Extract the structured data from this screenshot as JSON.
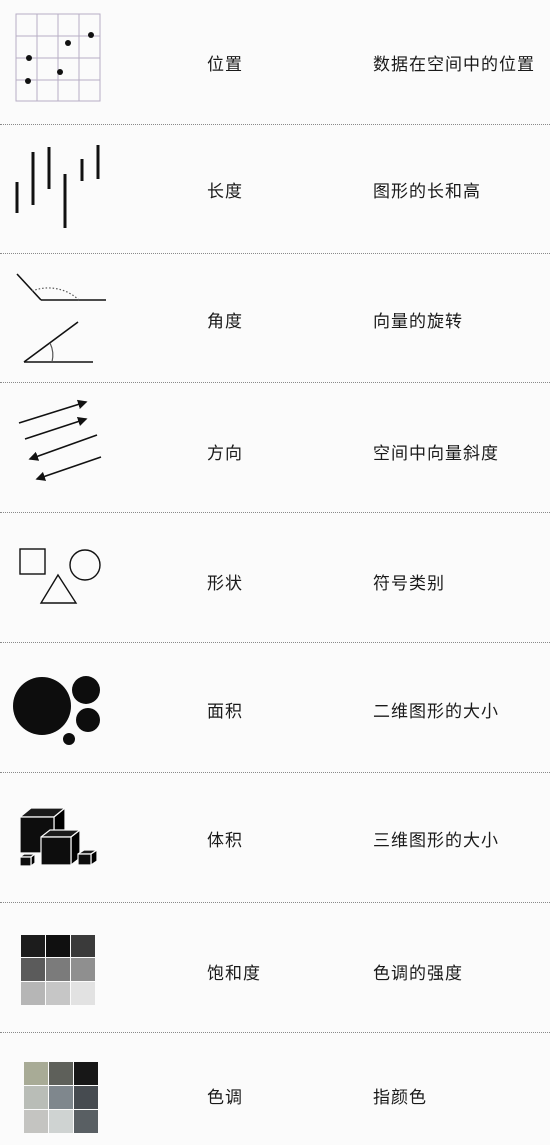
{
  "rows": [
    {
      "icon": "position-grid-icon",
      "name": "位置",
      "desc": "数据在空间中的位置"
    },
    {
      "icon": "length-bars-icon",
      "name": "长度",
      "desc": "图形的长和高"
    },
    {
      "icon": "angle-icon",
      "name": "角度",
      "desc": "向量的旋转"
    },
    {
      "icon": "direction-arrows-icon",
      "name": "方向",
      "desc": "空间中向量斜度"
    },
    {
      "icon": "shapes-icon",
      "name": "形状",
      "desc": "符号类别"
    },
    {
      "icon": "area-circles-icon",
      "name": "面积",
      "desc": "二维图形的大小"
    },
    {
      "icon": "volume-cubes-icon",
      "name": "体积",
      "desc": "三维图形的大小"
    },
    {
      "icon": "saturation-swatches-icon",
      "name": "饱和度",
      "desc": "色调的强度"
    },
    {
      "icon": "hue-swatches-icon",
      "name": "色调",
      "desc": "指颜色"
    }
  ]
}
